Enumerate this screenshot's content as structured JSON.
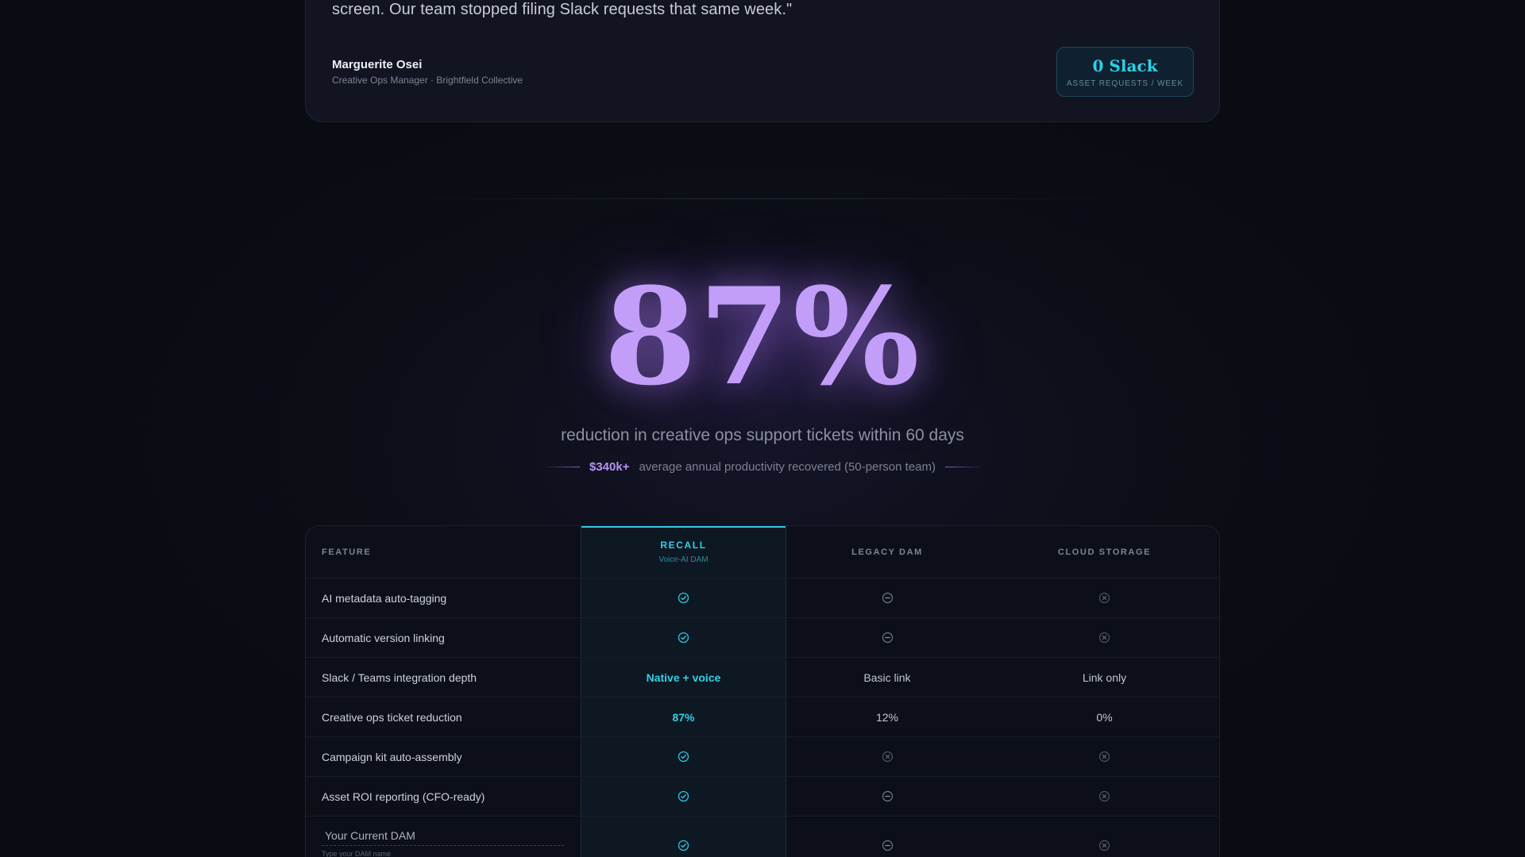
{
  "testimonial": {
    "quote_tail": "screen. Our team stopped filing Slack requests that same week.\"",
    "author_name": "Marguerite Osei",
    "author_role": "Creative Ops Manager · Brightfield Collective",
    "stat_value": "0 Slack",
    "stat_label": "ASSET REQUESTS / WEEK"
  },
  "headline_stat": {
    "value": "87%",
    "caption": "reduction in creative ops support tickets within 60 days",
    "sub_highlight": "$340k+",
    "sub_text": "average annual productivity recovered (50-person team)"
  },
  "comparison": {
    "headers": {
      "feature": "FEATURE",
      "recall": "RECALL",
      "recall_sub": "Voice-AI DAM",
      "legacy": "LEGACY DAM",
      "cloud": "CLOUD STORAGE"
    },
    "rows": [
      {
        "feature": "AI metadata auto-tagging",
        "recall": {
          "type": "icon",
          "icon": "check-icon"
        },
        "legacy": {
          "type": "icon",
          "icon": "dash-icon"
        },
        "cloud": {
          "type": "icon",
          "icon": "x-icon"
        }
      },
      {
        "feature": "Automatic version linking",
        "recall": {
          "type": "icon",
          "icon": "check-icon"
        },
        "legacy": {
          "type": "icon",
          "icon": "dash-icon"
        },
        "cloud": {
          "type": "icon",
          "icon": "x-icon"
        }
      },
      {
        "feature": "Slack / Teams integration depth",
        "recall": {
          "type": "text",
          "text": "Native + voice"
        },
        "legacy": {
          "type": "text",
          "text": "Basic link"
        },
        "cloud": {
          "type": "text",
          "text": "Link only"
        }
      },
      {
        "feature": "Creative ops ticket reduction",
        "recall": {
          "type": "text",
          "text": "87%"
        },
        "legacy": {
          "type": "text",
          "text": "12%"
        },
        "cloud": {
          "type": "text",
          "text": "0%"
        }
      },
      {
        "feature": "Campaign kit auto-assembly",
        "recall": {
          "type": "icon",
          "icon": "check-icon"
        },
        "legacy": {
          "type": "icon",
          "icon": "x-icon"
        },
        "cloud": {
          "type": "icon",
          "icon": "x-icon"
        }
      },
      {
        "feature": "Asset ROI reporting (CFO-ready)",
        "recall": {
          "type": "icon",
          "icon": "check-icon"
        },
        "legacy": {
          "type": "icon",
          "icon": "dash-icon"
        },
        "cloud": {
          "type": "icon",
          "icon": "x-icon"
        }
      }
    ],
    "input_row": {
      "placeholder": "Your Current DAM",
      "hint": "Type your DAM name",
      "recall": "check-icon",
      "legacy": "dash-icon",
      "cloud": "x-icon"
    }
  },
  "colors": {
    "accent_cyan": "#33cfe6",
    "accent_purple": "#c39ef8"
  }
}
